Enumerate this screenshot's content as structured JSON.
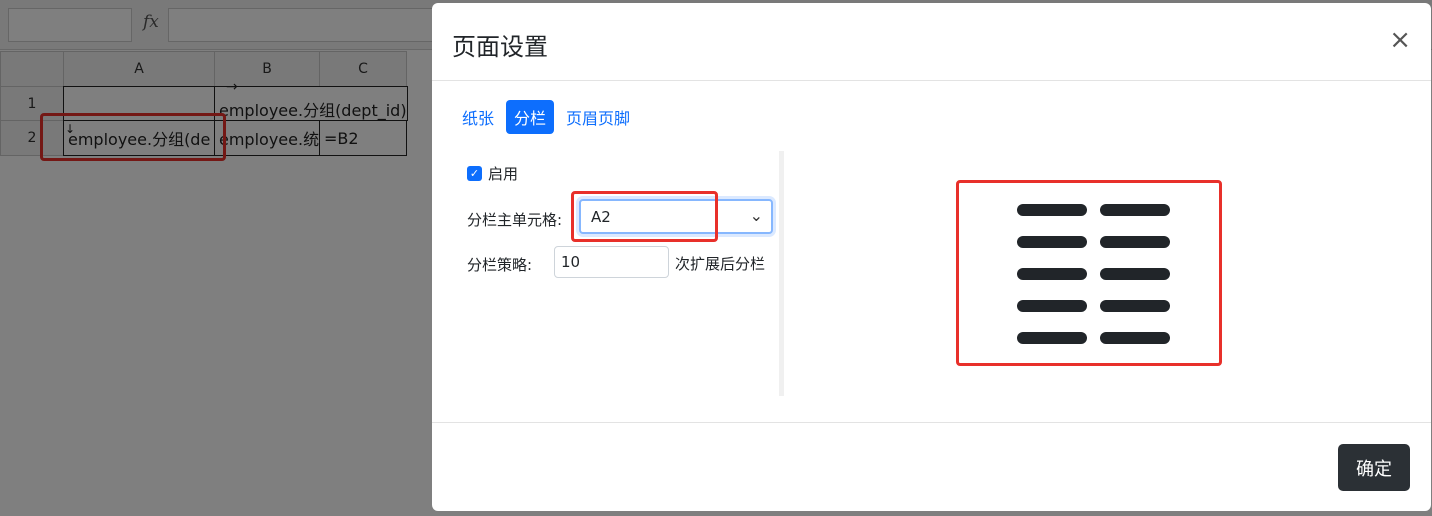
{
  "spreadsheet": {
    "fx_symbol": "fx",
    "columns": [
      "A",
      "B",
      "C"
    ],
    "rows": [
      "1",
      "2"
    ],
    "cells": {
      "B1": "employee.分组(dept_id)",
      "A2": "employee.分组(de",
      "B2": "employee.统",
      "C2": "=B2"
    },
    "arrows": {
      "right": "→",
      "down": "↓"
    }
  },
  "dialog": {
    "title": "页面设置",
    "close_symbol": "×",
    "tabs": [
      {
        "label": "纸张",
        "active": false
      },
      {
        "label": "分栏",
        "active": true
      },
      {
        "label": "页眉页脚",
        "active": false
      }
    ],
    "enable": {
      "label": "启用",
      "checked": true,
      "check_glyph": "✓"
    },
    "main_cell": {
      "label": "分栏主单元格:",
      "value": "A2",
      "chevron": "⌄"
    },
    "strategy": {
      "label": "分栏策略:",
      "value": "10",
      "suffix": "次扩展后分栏"
    },
    "preview": {
      "columns": 2,
      "rows": 5
    },
    "ok_label": "确定"
  },
  "colors": {
    "accent": "#0d6efd",
    "highlight": "#e8302a",
    "dark_button": "#2b3035"
  }
}
